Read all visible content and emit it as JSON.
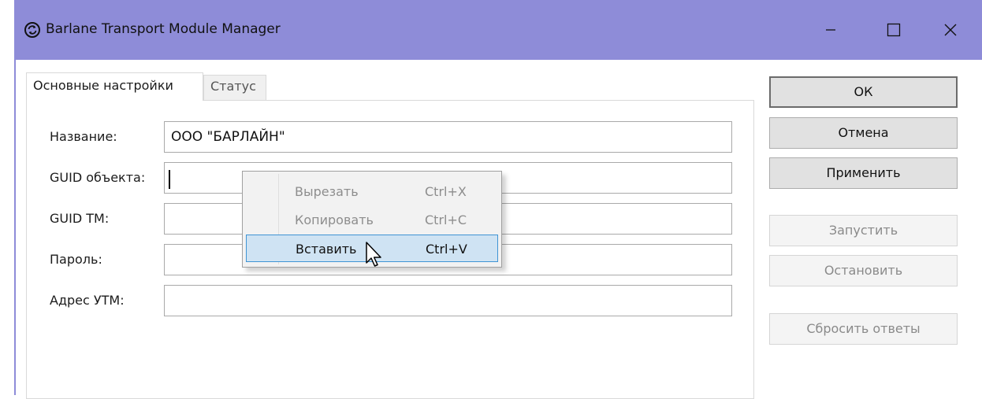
{
  "window": {
    "title": "Barlane Transport Module Manager",
    "app_icon": "refresh-circle-icon",
    "controls": {
      "minimize_icon": "minimize-icon",
      "maximize_icon": "maximize-icon",
      "close_icon": "close-icon"
    },
    "titlebar_color": "#8e8cd8"
  },
  "tabs": [
    {
      "label": "Основные настройки",
      "active": true
    },
    {
      "label": "Статус",
      "active": false
    }
  ],
  "form": {
    "name": {
      "label": "Название:",
      "value": "ООО \"БАРЛАЙН\""
    },
    "guid_object": {
      "label": "GUID объекта:",
      "value": ""
    },
    "guid_tm": {
      "label": "GUID TM:",
      "value": ""
    },
    "password": {
      "label": "Пароль:",
      "value": ""
    },
    "utm_address": {
      "label": "Адрес УТМ:",
      "value": ""
    }
  },
  "buttons": {
    "ok": "ОК",
    "cancel": "Отмена",
    "apply": "Применить",
    "start": "Запустить",
    "stop": "Остановить",
    "reset": "Сбросить ответы"
  },
  "context_menu": {
    "items": [
      {
        "label": "Вырезать",
        "shortcut": "Ctrl+X",
        "enabled": false
      },
      {
        "label": "Копировать",
        "shortcut": "Ctrl+C",
        "enabled": false
      },
      {
        "label": "Вставить",
        "shortcut": "Ctrl+V",
        "enabled": true,
        "highlighted": true
      }
    ],
    "highlight_color": "#cfe3f3"
  }
}
